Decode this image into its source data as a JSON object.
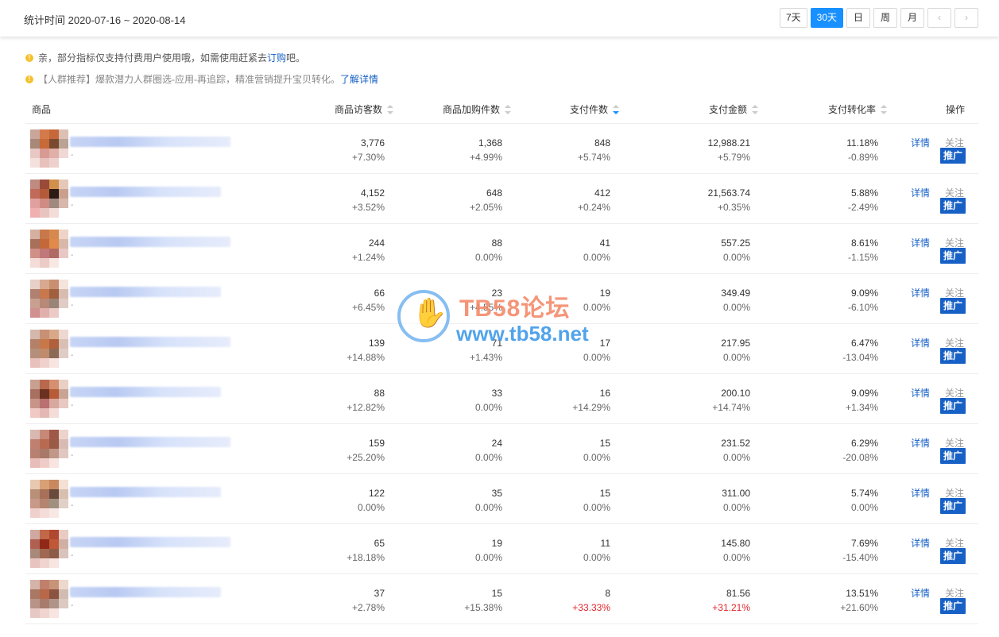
{
  "header": {
    "stat_time": "统计时间 2020-07-16 ~ 2020-08-14",
    "periods": [
      {
        "label": "7天",
        "active": false
      },
      {
        "label": "30天",
        "active": true
      },
      {
        "label": "日",
        "active": false
      },
      {
        "label": "周",
        "active": false
      },
      {
        "label": "月",
        "active": false
      }
    ],
    "prev_arrow": "‹",
    "next_arrow": "›"
  },
  "notices": {
    "n1_text": "亲，部分指标仅支持付费用户使用哦，如需使用赶紧去",
    "n1_link": "订购",
    "n1_suffix": "吧。",
    "n2_text": "【人群推荐】爆款潜力人群圈选-应用-再追踪，精准营销提升宝贝转化。",
    "n2_link": "了解详情"
  },
  "table": {
    "headers": {
      "product": "商品",
      "visitors": "商品访客数",
      "cart": "商品加购件数",
      "paid_items": "支付件数",
      "paid_amount": "支付金额",
      "conversion": "支付转化率",
      "action": "操作"
    },
    "action_labels": {
      "detail": "详情",
      "follow": "关注",
      "promote": "推广"
    },
    "rows": [
      {
        "dash": "-",
        "visitors": "3,776",
        "visitors_chg": "+7.30%",
        "cart": "1,368",
        "cart_chg": "+4.99%",
        "paid": "848",
        "paid_chg": "+5.74%",
        "amount": "12,988.21",
        "amount_chg": "+5.79%",
        "conv": "11.18%",
        "conv_chg": "-0.89%"
      },
      {
        "dash": "-",
        "visitors": "4,152",
        "visitors_chg": "+3.52%",
        "cart": "648",
        "cart_chg": "+2.05%",
        "paid": "412",
        "paid_chg": "+0.24%",
        "amount": "21,563.74",
        "amount_chg": "+0.35%",
        "conv": "5.88%",
        "conv_chg": "-2.49%"
      },
      {
        "dash": "-",
        "visitors": "244",
        "visitors_chg": "+1.24%",
        "cart": "88",
        "cart_chg": "0.00%",
        "paid": "41",
        "paid_chg": "0.00%",
        "amount": "557.25",
        "amount_chg": "0.00%",
        "conv": "8.61%",
        "conv_chg": "-1.15%"
      },
      {
        "dash": "-",
        "visitors": "66",
        "visitors_chg": "+6.45%",
        "cart": "23",
        "cart_chg": "+4.55%",
        "paid": "19",
        "paid_chg": "0.00%",
        "amount": "349.49",
        "amount_chg": "0.00%",
        "conv": "9.09%",
        "conv_chg": "-6.10%"
      },
      {
        "dash": "-",
        "visitors": "139",
        "visitors_chg": "+14.88%",
        "cart": "71",
        "cart_chg": "+1.43%",
        "paid": "17",
        "paid_chg": "0.00%",
        "amount": "217.95",
        "amount_chg": "0.00%",
        "conv": "6.47%",
        "conv_chg": "-13.04%"
      },
      {
        "dash": "-",
        "visitors": "88",
        "visitors_chg": "+12.82%",
        "cart": "33",
        "cart_chg": "0.00%",
        "paid": "16",
        "paid_chg": "+14.29%",
        "amount": "200.10",
        "amount_chg": "+14.74%",
        "conv": "9.09%",
        "conv_chg": "+1.34%"
      },
      {
        "dash": "-",
        "visitors": "159",
        "visitors_chg": "+25.20%",
        "cart": "24",
        "cart_chg": "0.00%",
        "paid": "15",
        "paid_chg": "0.00%",
        "amount": "231.52",
        "amount_chg": "0.00%",
        "conv": "6.29%",
        "conv_chg": "-20.08%"
      },
      {
        "dash": "-",
        "visitors": "122",
        "visitors_chg": "0.00%",
        "cart": "35",
        "cart_chg": "0.00%",
        "paid": "15",
        "paid_chg": "0.00%",
        "amount": "311.00",
        "amount_chg": "0.00%",
        "conv": "5.74%",
        "conv_chg": "0.00%"
      },
      {
        "dash": "-",
        "visitors": "65",
        "visitors_chg": "+18.18%",
        "cart": "19",
        "cart_chg": "0.00%",
        "paid": "11",
        "paid_chg": "0.00%",
        "amount": "145.80",
        "amount_chg": "0.00%",
        "conv": "7.69%",
        "conv_chg": "-15.40%"
      },
      {
        "dash": "-",
        "visitors": "37",
        "visitors_chg": "+2.78%",
        "cart": "15",
        "cart_chg": "+15.38%",
        "paid": "8",
        "paid_chg": "+33.33%",
        "amount": "81.56",
        "amount_chg": "+31.21%",
        "conv": "13.51%",
        "conv_chg": "+21.60%"
      }
    ]
  },
  "watermark": {
    "title": "TB58论坛",
    "url": "www.tb58.net"
  },
  "colors": {
    "accent": "#1890ff",
    "link": "#1660c6",
    "positive_red": "#e4252c",
    "warning": "#f5c02b"
  }
}
